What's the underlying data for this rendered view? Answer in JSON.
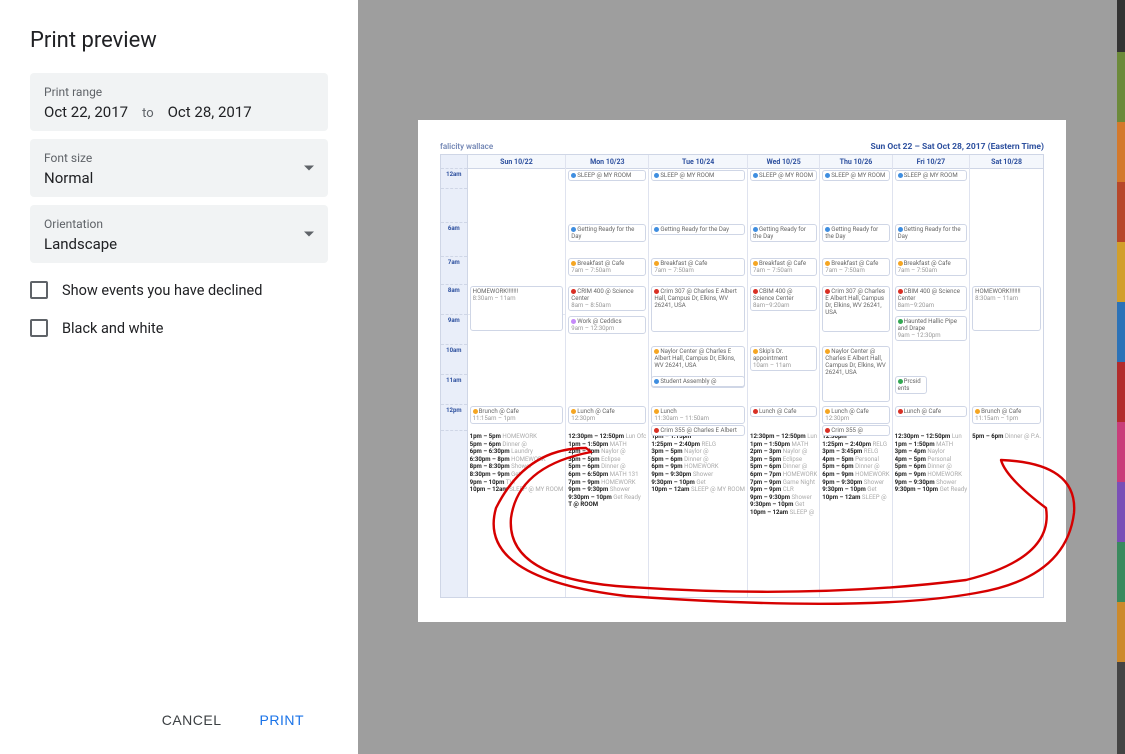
{
  "title": "Print preview",
  "print_range": {
    "label": "Print range",
    "start": "Oct 22, 2017",
    "to": "to",
    "end": "Oct 28, 2017"
  },
  "font_size": {
    "label": "Font size",
    "value": "Normal"
  },
  "orientation": {
    "label": "Orientation",
    "value": "Landscape"
  },
  "checks": {
    "declined": "Show events you have declined",
    "bw": "Black and white"
  },
  "buttons": {
    "cancel": "CANCEL",
    "print": "PRINT"
  },
  "calendar": {
    "owner": "falicity wallace",
    "range_text": "Sun Oct 22 – Sat Oct 28, 2017 (Eastern Time)",
    "days": [
      "Sun 10/22",
      "Mon 10/23",
      "Tue 10/24",
      "Wed 10/25",
      "Thu 10/26",
      "Fri 10/27",
      "Sat 10/28"
    ],
    "hours": [
      "12am",
      "",
      "6am",
      "7am",
      "8am",
      "9am",
      "10am",
      "11am",
      "12pm"
    ],
    "top_events": {
      "sleep": {
        "title": "SLEEP @ MY ROOM",
        "color": "#3f8ee0"
      },
      "ready": {
        "title": "Getting Ready for the Day",
        "color": "#3f8ee0"
      },
      "breakfast": {
        "title": "Breakfast @ Cafe",
        "time": "7am – 7:50am",
        "color": "#f5a623"
      },
      "crim400": {
        "title": "CRIM 400 @ Science Center",
        "time": "8am – 8:50am",
        "color": "#d93025"
      },
      "crim307": {
        "title": "Crim 307 @ Charles E Albert Hall, Campus Dr, Elkins, WV 26241, USA",
        "color": "#d93025"
      },
      "cbim400": {
        "title": "CBIM 400 @ Science Center",
        "time": "8am–9:20am",
        "color": "#d93025"
      },
      "work": {
        "title": "Work @ Ceddics",
        "time": "9am – 12:30pm",
        "color": "#c58af9"
      },
      "naylor": {
        "title": "Naylor Center @ Charles E Albert Hall, Campus Dr, Elkins, WV 26241, USA",
        "color": "#f5a623"
      },
      "skips": {
        "title": "Skip's Dr. appointment",
        "time": "10am – 11am",
        "color": "#f5a623"
      },
      "student": {
        "title": "Student Assembly @",
        "color": "#3f8ee0"
      },
      "homework_sun": {
        "title": "HOMEWORK!!!!!!!",
        "time": "8:30am – 11am"
      },
      "brunch": {
        "title": "Brunch @ Cafe",
        "time": "11:15am – 1pm",
        "color": "#f5a623"
      },
      "lunch": {
        "title": "Lunch",
        "time": "11:30am – 11:50am",
        "color": "#f5a623"
      },
      "lunch_cafe": {
        "title": "Lunch @ Cafe",
        "time": "12:30pm",
        "color": "#f5a623"
      },
      "lunch_red": {
        "title": "Lunch @ Cafe",
        "color": "#d93025"
      },
      "crim355": {
        "title": "Crim 355 @ Charles E Albert",
        "color": "#d93025"
      },
      "prcsid": {
        "title": "Prcsid ents",
        "color": "#34a853"
      },
      "haunted": {
        "title": "Haunted Hallic Pipe and Drape",
        "time": "9am – 12:30pm",
        "color": "#34a853"
      },
      "homework_sat": {
        "title": "HOMEWORK!!!!!!!",
        "time": "8:30am – 11am"
      }
    },
    "dense": {
      "sun": [
        {
          "t": "1pm – 5pm",
          "v": "HOMEWORK"
        },
        {
          "t": "5pm – 6pm",
          "v": "Dinner @"
        },
        {
          "t": "6pm – 6:30pm",
          "v": "Laundry"
        },
        {
          "t": "6:30pm – 8pm",
          "v": "HOMEWORK"
        },
        {
          "t": "8pm – 8:30pm",
          "v": "Shower"
        },
        {
          "t": "8:30pm – 9pm",
          "v": "Get"
        },
        {
          "t": "9pm – 10pm",
          "v": "TV!"
        },
        {
          "t": "10pm – 12am",
          "v": "SLEEP @ MY ROOM"
        }
      ],
      "mon": [
        {
          "t": "12:30pm – 12:50pm",
          "v": "Lun Ofc"
        },
        {
          "t": "1pm – 1:50pm",
          "v": "MATH"
        },
        {
          "t": "2pm – 3pm",
          "v": "Naylor @"
        },
        {
          "t": "3pm – 5pm",
          "v": "Eclipse"
        },
        {
          "t": "5pm – 6pm",
          "v": "Dinner @"
        },
        {
          "t": "6pm – 6:50pm",
          "v": "MATH 131"
        },
        {
          "t": "7pm – 9pm",
          "v": "HOMEWORK"
        },
        {
          "t": "9pm – 9:30pm",
          "v": "Shower"
        },
        {
          "t": "9:30pm – 10pm",
          "v": "Get Ready"
        },
        {
          "t": "T @ ROOM",
          "v": ""
        }
      ],
      "tue": [
        {
          "t": "1pm – 1:15pm",
          "v": ""
        },
        {
          "t": "1:25pm – 2:40pm",
          "v": "RELG"
        },
        {
          "t": "3pm – 5pm",
          "v": "Naylor @"
        },
        {
          "t": "5pm – 6pm",
          "v": "Dinner @"
        },
        {
          "t": "6pm – 9pm",
          "v": "HOMEWORK"
        },
        {
          "t": "9pm – 9:30pm",
          "v": "Shower"
        },
        {
          "t": "9:30pm – 10pm",
          "v": "Get"
        },
        {
          "t": "10pm – 12am",
          "v": "SLEEP @ MY ROOM"
        }
      ],
      "wed": [
        {
          "t": "12:30pm – 12:50pm",
          "v": "Lun"
        },
        {
          "t": "1pm – 1:50pm",
          "v": "MATH"
        },
        {
          "t": "2pm – 3pm",
          "v": "Naylor @"
        },
        {
          "t": "3pm – 5pm",
          "v": "Eclipse"
        },
        {
          "t": "5pm – 6pm",
          "v": "Dinner @"
        },
        {
          "t": "6pm – 7pm",
          "v": "HOMEWORK"
        },
        {
          "t": "7pm – 9pm",
          "v": "Game Night"
        },
        {
          "t": "9pm – 9pm",
          "v": "CLR"
        },
        {
          "t": "9pm – 9:30pm",
          "v": "Shower"
        },
        {
          "t": "9:30pm – 10pm",
          "v": "Get"
        },
        {
          "t": "10pm – 12am",
          "v": "SLEEP @"
        }
      ],
      "thu": [
        {
          "t": "12:30pm",
          "v": ""
        },
        {
          "t": "1:25pm – 2:40pm",
          "v": "RELG"
        },
        {
          "t": "3pm – 3:45pm",
          "v": "RELG"
        },
        {
          "t": "4pm – 5pm",
          "v": "Personal"
        },
        {
          "t": "5pm – 6pm",
          "v": "Dinner @"
        },
        {
          "t": "6pm – 9pm",
          "v": "HOMEWORK"
        },
        {
          "t": "9pm – 9:30pm",
          "v": "Shower"
        },
        {
          "t": "9:30pm – 10pm",
          "v": "Get"
        },
        {
          "t": "10pm – 12am",
          "v": "SLEEP @"
        }
      ],
      "fri": [
        {
          "t": "12:30pm – 12:50pm",
          "v": "Lun"
        },
        {
          "t": "1pm – 1:50pm",
          "v": "MATH"
        },
        {
          "t": "3pm – 4pm",
          "v": "Naylor"
        },
        {
          "t": "4pm – 5pm",
          "v": "Personal"
        },
        {
          "t": "5pm – 6pm",
          "v": "Dinner @"
        },
        {
          "t": "6pm – 9pm",
          "v": "HOMEWORK"
        },
        {
          "t": "9pm – 9:30pm",
          "v": "Shower"
        },
        {
          "t": "9:30pm – 10pm",
          "v": "Get Ready"
        }
      ],
      "sat": [
        {
          "t": "5pm – 6pm",
          "v": "Dinner @ P.A."
        }
      ]
    }
  }
}
